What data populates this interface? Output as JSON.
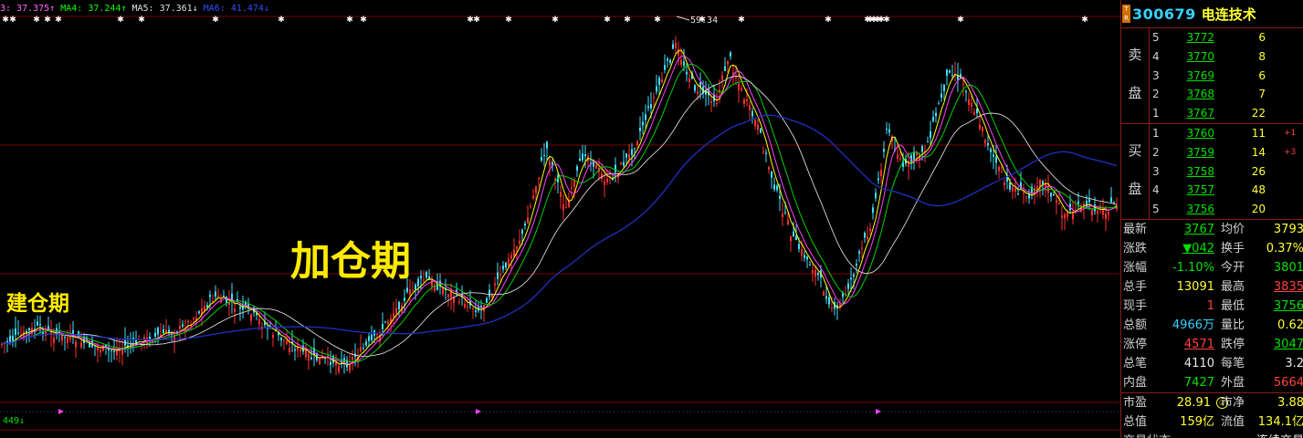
{
  "ma_bar": [
    {
      "text": "3: 37.375↑",
      "color": "#ff66ff"
    },
    {
      "text": "MA4: 37.244↑",
      "color": "#00ff00"
    },
    {
      "text": "MA5: 37.361↓",
      "color": "#e0e0e0"
    },
    {
      "text": "MA6: 41.474↓",
      "color": "#3050ff"
    }
  ],
  "annotations": {
    "build": "建仓期",
    "add": "加仓期"
  },
  "chart_labels": {
    "high": "59.34",
    "bottom_num": "449↓"
  },
  "colors": {
    "grid": "#7a0000",
    "ma_blue": "#2030c0",
    "ma_white": "#d8d8d8",
    "ma_yellow": "#ffff00",
    "ma_magenta": "#ff40ff",
    "ma_green": "#00d000",
    "up": "#ff3030",
    "down": "#40e0ff"
  },
  "stock": {
    "badge": "T R",
    "code": "300679",
    "name": "电连技术"
  },
  "order_book": {
    "sell_label": [
      "卖",
      "盘"
    ],
    "buy_label": [
      "买",
      "盘"
    ],
    "sell": [
      {
        "lvl": "5",
        "price": "3772",
        "vol": "6",
        "chg": ""
      },
      {
        "lvl": "4",
        "price": "3770",
        "vol": "8",
        "chg": ""
      },
      {
        "lvl": "3",
        "price": "3769",
        "vol": "6",
        "chg": ""
      },
      {
        "lvl": "2",
        "price": "3768",
        "vol": "7",
        "chg": ""
      },
      {
        "lvl": "1",
        "price": "3767",
        "vol": "22",
        "chg": ""
      }
    ],
    "buy": [
      {
        "lvl": "1",
        "price": "3760",
        "vol": "11",
        "chg": "+1"
      },
      {
        "lvl": "2",
        "price": "3759",
        "vol": "14",
        "chg": "+3"
      },
      {
        "lvl": "3",
        "price": "3758",
        "vol": "26",
        "chg": ""
      },
      {
        "lvl": "4",
        "price": "3757",
        "vol": "48",
        "chg": ""
      },
      {
        "lvl": "5",
        "price": "3756",
        "vol": "20",
        "chg": ""
      }
    ]
  },
  "stats": [
    {
      "l1": "最新",
      "v1": "3767",
      "c1": "g u",
      "l2": "均价",
      "v2": "3793",
      "c2": "y"
    },
    {
      "l1": "涨跌",
      "v1": "▼042",
      "c1": "g u",
      "l2": "换手",
      "v2": "0.37%",
      "c2": "y"
    },
    {
      "l1": "涨幅",
      "v1": "-1.10%",
      "c1": "g",
      "l2": "今开",
      "v2": "3801",
      "c2": "g"
    },
    {
      "l1": "总手",
      "v1": "13091",
      "c1": "y",
      "l2": "最高",
      "v2": "3835",
      "c2": "r u"
    },
    {
      "l1": "现手",
      "v1": "1",
      "c1": "r",
      "l2": "最低",
      "v2": "3756",
      "c2": "g u"
    },
    {
      "l1": "总额",
      "v1": "4966万",
      "c1": "c",
      "l2": "量比",
      "v2": "0.62",
      "c2": "y"
    },
    {
      "l1": "涨停",
      "v1": "4571",
      "c1": "r u",
      "l2": "跌停",
      "v2": "3047",
      "c2": "g u"
    },
    {
      "l1": "总笔",
      "v1": "4110",
      "c1": "w",
      "l2": "每笔",
      "v2": "3.2",
      "c2": "w"
    },
    {
      "l1": "内盘",
      "v1": "7427",
      "c1": "g",
      "l2": "外盘",
      "v2": "5664",
      "c2": "r"
    }
  ],
  "stats2": [
    {
      "l1": "市盈",
      "v1": "28.91",
      "c1": "y",
      "circ": "③",
      "l2": "市净",
      "v2": "3.88",
      "c2": "y"
    },
    {
      "l1": "总值",
      "v1": "159亿",
      "c1": "y",
      "l2": "流值",
      "v2": "134.1亿",
      "c2": "y"
    },
    {
      "l1": "交易状态",
      "v1": "",
      "c1": "w",
      "l2": "",
      "v2": "连续交易",
      "c2": "w"
    }
  ]
}
